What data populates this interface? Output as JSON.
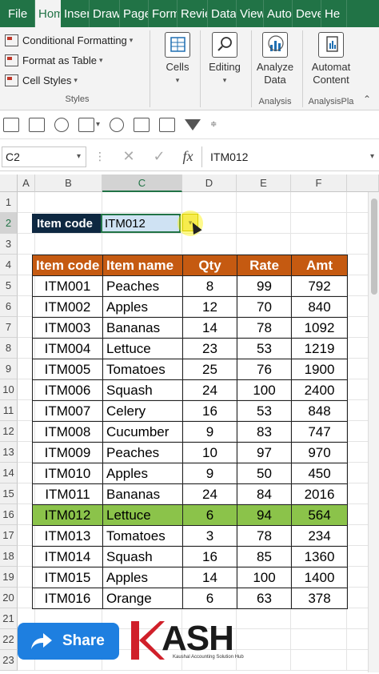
{
  "ribbon": {
    "tabs": [
      "File",
      "Hom",
      "Inser",
      "Draw",
      "Page",
      "Form",
      "Revie",
      "Data",
      "View",
      "Auto",
      "Deve",
      "He"
    ],
    "active_tab_index": 1,
    "styles": {
      "conditional_formatting": "Conditional Formatting",
      "format_as_table": "Format as Table",
      "cell_styles": "Cell Styles",
      "group_label": "Styles"
    },
    "cells_label": "Cells",
    "editing_label": "Editing",
    "analyze_data": "Analyze Data",
    "analysis_label": "Analysis",
    "automate_content": "Automat Content",
    "analysis_plugin_label": "AnalysisPla"
  },
  "formula_bar": {
    "name_box": "C2",
    "formula": "ITM012",
    "fx": "fx"
  },
  "grid": {
    "columns": [
      "A",
      "B",
      "C",
      "D",
      "E",
      "F"
    ],
    "selected_column": "C",
    "rows": [
      "1",
      "2",
      "3",
      "4",
      "5",
      "6",
      "7",
      "8",
      "9",
      "10",
      "11",
      "12",
      "13",
      "14",
      "15",
      "16",
      "17",
      "18",
      "19",
      "20",
      "21",
      "22",
      "23"
    ],
    "selected_row": "2"
  },
  "lookup": {
    "label": "Item code",
    "value": "ITM012"
  },
  "table": {
    "headers": [
      "Item code",
      "Item name",
      "Qty",
      "Rate",
      "Amt"
    ],
    "highlight_row_index": 11,
    "rows": [
      [
        "ITM001",
        "Peaches",
        "8",
        "99",
        "792"
      ],
      [
        "ITM002",
        "Apples",
        "12",
        "70",
        "840"
      ],
      [
        "ITM003",
        "Bananas",
        "14",
        "78",
        "1092"
      ],
      [
        "ITM004",
        "Lettuce",
        "23",
        "53",
        "1219"
      ],
      [
        "ITM005",
        "Tomatoes",
        "25",
        "76",
        "1900"
      ],
      [
        "ITM006",
        "Squash",
        "24",
        "100",
        "2400"
      ],
      [
        "ITM007",
        "Celery",
        "16",
        "53",
        "848"
      ],
      [
        "ITM008",
        "Cucumber",
        "9",
        "83",
        "747"
      ],
      [
        "ITM009",
        "Peaches",
        "10",
        "97",
        "970"
      ],
      [
        "ITM010",
        "Apples",
        "9",
        "50",
        "450"
      ],
      [
        "ITM011",
        "Bananas",
        "24",
        "84",
        "2016"
      ],
      [
        "ITM012",
        "Lettuce",
        "6",
        "94",
        "564"
      ],
      [
        "ITM013",
        "Tomatoes",
        "3",
        "78",
        "234"
      ],
      [
        "ITM014",
        "Squash",
        "16",
        "85",
        "1360"
      ],
      [
        "ITM015",
        "Apples",
        "14",
        "100",
        "1400"
      ],
      [
        "ITM016",
        "Orange",
        "6",
        "63",
        "378"
      ]
    ]
  },
  "share": {
    "label": "Share"
  },
  "logo": {
    "name": "KASH",
    "tagline": "Kaushal Accounting Solution Hub"
  },
  "colors": {
    "excel_green": "#217346",
    "header_orange": "#c55a11",
    "highlight_green": "#8bc34a",
    "lookup_label_bg": "#0e2841",
    "share_blue": "#1e7fe0",
    "logo_red": "#d0202a"
  }
}
